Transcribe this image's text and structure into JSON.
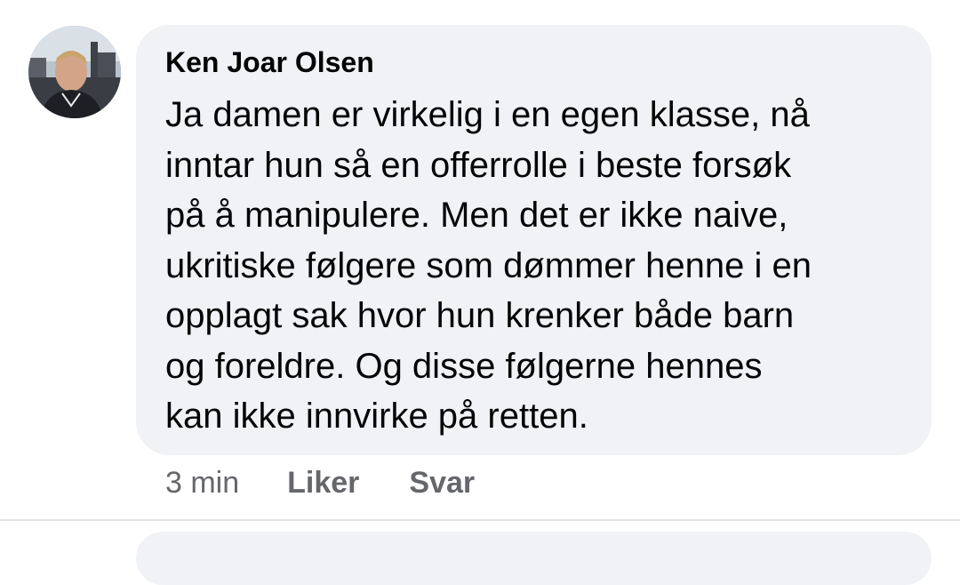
{
  "comment": {
    "author": "Ken Joar Olsen",
    "avatar_icon": "profile-photo",
    "lines": [
      "Ja damen er virkelig i en egen klasse, nå",
      "inntar hun så en offerrolle i beste forsøk",
      "på å manipulere. Men det er ikke naive,",
      "ukritiske følgere som dømmer henne i en",
      "opplagt sak hvor hun krenker både barn",
      "og foreldre. Og disse følgerne hennes",
      "kan ikke innvirke på retten."
    ],
    "time": "3 min",
    "like_label": "Liker",
    "reply_label": "Svar"
  },
  "colors": {
    "bubble_bg": "#f0f2f5",
    "text": "#050505",
    "secondary_text": "#65676b",
    "divider": "#e1e3e6"
  }
}
